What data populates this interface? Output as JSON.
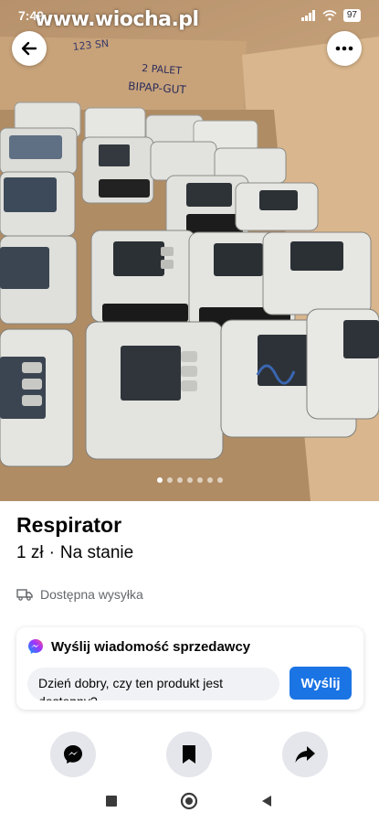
{
  "statusbar": {
    "time": "7:49",
    "battery": "97",
    "watermark": "www.wiocha.pl"
  },
  "photo": {
    "box_label_1": "2 PALET",
    "box_label_2": "BIPAP-GUT",
    "box_label_3": "123 SN"
  },
  "carousel": {
    "total": 7,
    "active": 1
  },
  "listing": {
    "title": "Respirator",
    "price": "1 zł",
    "separator": "·",
    "availability": "Na stanie",
    "shipping": "Dostępna wysyłka"
  },
  "message": {
    "header": "Wyślij wiadomość sprzedawcy",
    "input_value": "Dzień dobry, czy ten produkt jest dostępny?",
    "send_label": "Wyślij"
  },
  "colors": {
    "accent": "#1b74e4",
    "secondary_text": "#65676b",
    "button_bg": "#e4e6eb"
  },
  "icons": {
    "back": "arrow-left-icon",
    "more": "more-horizontal-icon",
    "truck": "truck-icon",
    "messenger": "messenger-icon",
    "save": "bookmark-icon",
    "share": "share-icon"
  }
}
